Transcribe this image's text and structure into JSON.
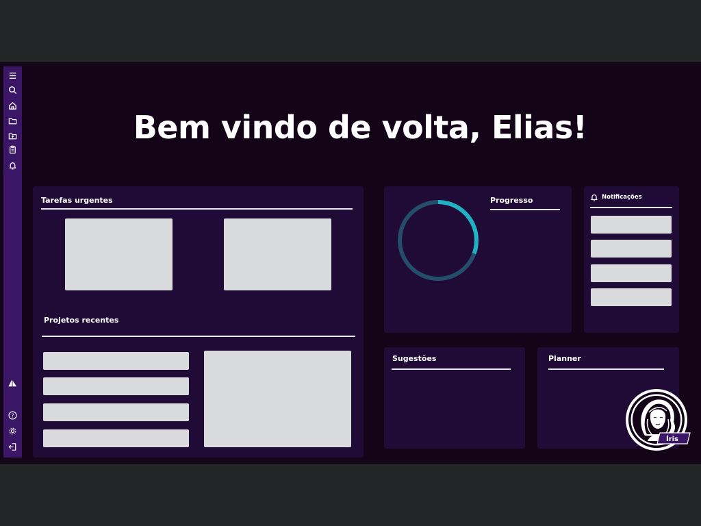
{
  "sidebar": {
    "top_icons": [
      "menu-icon",
      "search-icon",
      "home-icon",
      "folder-icon",
      "folder-upload-icon",
      "clipboard-icon",
      "bell-icon"
    ],
    "bottom_icons": [
      "sailboat-icon",
      "help-icon",
      "gear-icon",
      "logout-icon"
    ]
  },
  "header": {
    "welcome": "Bem vindo de volta, Elias!"
  },
  "urgent_tasks": {
    "title": "Tarefas urgentes",
    "card_count": 2
  },
  "recent_projects": {
    "title": "Projetos recentes",
    "list_count": 4
  },
  "progress": {
    "title": "Progresso",
    "ring_colors": {
      "filled": "#1fb2c2",
      "track": "#244d6b"
    }
  },
  "notifications": {
    "title": "Notificações",
    "item_count": 4
  },
  "suggestions": {
    "title": "Sugestões"
  },
  "planner": {
    "title": "Planner"
  },
  "assistant": {
    "name": "Íris"
  },
  "colors": {
    "background": "#130417",
    "panel": "#200a36",
    "sidebar": "#3b1667",
    "placeholder": "#d9dadb",
    "accent": "#1fb2c2"
  }
}
